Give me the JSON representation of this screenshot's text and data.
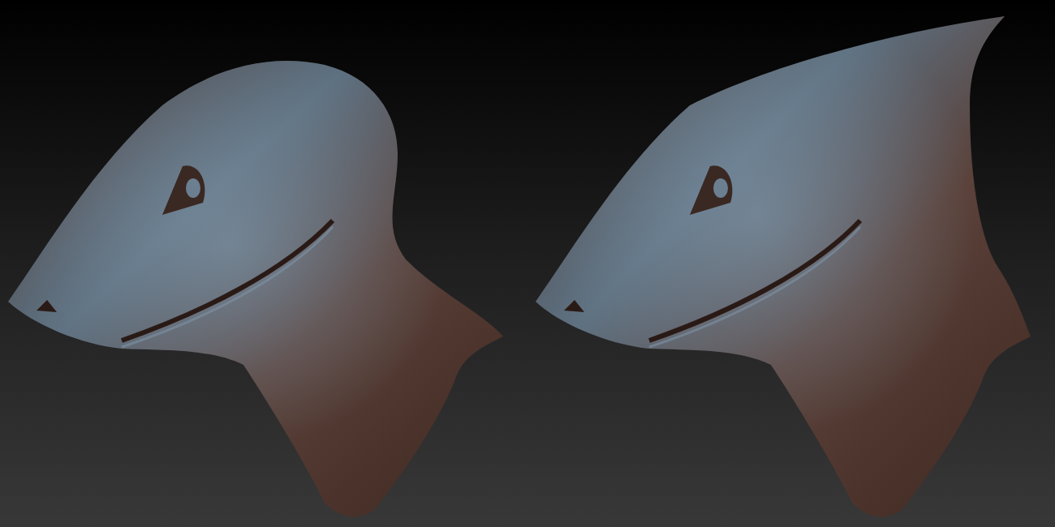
{
  "viewport": {
    "models": [
      {
        "kind": "head"
      },
      {
        "kind": "horned-head"
      }
    ]
  }
}
